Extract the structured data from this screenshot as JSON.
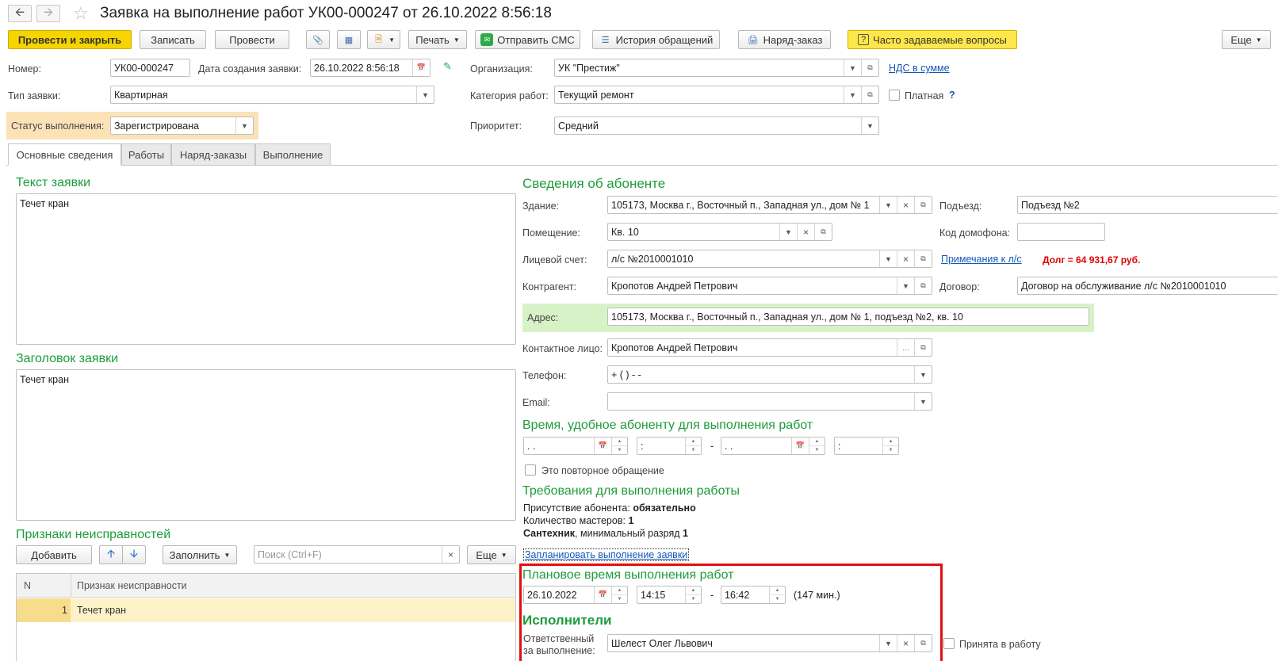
{
  "window": {
    "title": "Заявка на выполнение работ УК00-000247 от 26.10.2022 8:56:18"
  },
  "toolbar": {
    "post_close": "Провести и закрыть",
    "save": "Записать",
    "post": "Провести",
    "print": "Печать",
    "send_sms": "Отправить СМС",
    "history": "История обращений",
    "work_order": "Наряд-заказ",
    "faq": "Часто задаваемые вопросы",
    "more": "Еще"
  },
  "header": {
    "number_label": "Номер:",
    "number": "УК00-000247",
    "created_label": "Дата создания заявки:",
    "created": "26.10.2022  8:56:18",
    "org_label": "Организация:",
    "org": "УК \"Престиж\"",
    "vat_link": "НДС в сумме",
    "type_label": "Тип заявки:",
    "type": "Квартирная",
    "category_label": "Категория работ:",
    "category": "Текущий ремонт",
    "paid_label": "Платная",
    "help": "?",
    "status_label": "Статус выполнения:",
    "status": "Зарегистрирована",
    "priority_label": "Приоритет:",
    "priority": "Средний"
  },
  "tabs": [
    "Основные сведения",
    "Работы",
    "Наряд-заказы",
    "Выполнение"
  ],
  "left": {
    "text_title": "Текст заявки",
    "text_value": "Течет кран",
    "heading_title": "Заголовок заявки",
    "heading_value": "Течет кран",
    "faults_title": "Признаки неисправностей",
    "add": "Добавить",
    "fill": "Заполнить",
    "search_placeholder": "Поиск (Ctrl+F)",
    "more": "Еще",
    "table": {
      "col_n": "N",
      "col_sign": "Признак неисправности",
      "rows": [
        {
          "n": "1",
          "sign": "Течет кран"
        }
      ]
    }
  },
  "subscriber": {
    "title": "Сведения об абоненте",
    "building_label": "Здание:",
    "building": "105173, Москва г., Восточный п., Западная ул., дом № 1",
    "entrance_label": "Подъезд:",
    "entrance": "Подъезд №2",
    "room_label": "Помещение:",
    "room": "Кв. 10",
    "intercom_label": "Код домофона:",
    "intercom": "",
    "account_label": "Лицевой счет:",
    "account": "л/с №2010001010",
    "notes_link": "Примечания к л/с",
    "debt": "Долг = 64 931,67 руб.",
    "contractor_label": "Контрагент:",
    "contractor": "Кропотов Андрей Петрович",
    "contract_label": "Договор:",
    "contract": "Договор на обслуживание л/с №2010001010",
    "address_label": "Адрес:",
    "address": "105173, Москва г., Восточный п., Западная ул., дом № 1, подъезд №2, кв. 10",
    "contact_label": "Контактное лицо:",
    "contact": "Кропотов Андрей Петрович",
    "phone_label": "Телефон:",
    "phone": "+ (   )   -  -",
    "email_label": "Email:",
    "email": ""
  },
  "convenient": {
    "title": "Время, удобное абоненту для выполнения работ",
    "date_from": " .  .",
    "time_from": " :",
    "dash": "-",
    "date_to": " .  .",
    "time_to": " :",
    "repeat_label": "Это повторное обращение"
  },
  "requirements": {
    "title": "Требования для выполнения работы",
    "presence_label": "Присутствие абонента:",
    "presence_value": "обязательно",
    "masters_label": "Количество мастеров:",
    "masters_value": "1",
    "specialty": "Сантехник",
    "rank_label": ", минимальный разряд",
    "rank_value": "1",
    "plan_link": "Запланировать выполнение заявки"
  },
  "planned": {
    "title": "Плановое время выполнения работ",
    "date": "26.10.2022",
    "time_from": "14:15",
    "dash": "-",
    "time_to": "16:42",
    "duration": "(147 мин.)"
  },
  "executors": {
    "title": "Исполнители",
    "responsible_label_1": "Ответственный",
    "responsible_label_2": "за выполнение:",
    "responsible": "Шелест Олег Львович",
    "accepted_label": "Принята в работу"
  }
}
